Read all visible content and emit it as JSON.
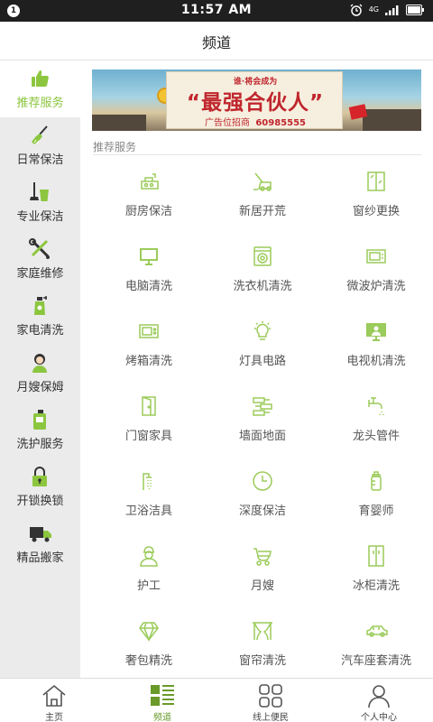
{
  "status_bar": {
    "notification_count": "1",
    "time": "11:57 AM",
    "network": "4G"
  },
  "header": {
    "title": "频道"
  },
  "sidebar": {
    "items": [
      {
        "label": "推荐服务",
        "icon": "thumbs-up-icon",
        "active": true
      },
      {
        "label": "日常保洁",
        "icon": "broom-icon"
      },
      {
        "label": "专业保洁",
        "icon": "mop-bucket-icon"
      },
      {
        "label": "家庭维修",
        "icon": "wrench-screwdriver-icon"
      },
      {
        "label": "家电清洗",
        "icon": "spray-bottle-icon"
      },
      {
        "label": "月嫂保姆",
        "icon": "nanny-icon"
      },
      {
        "label": "洗护服务",
        "icon": "detergent-icon"
      },
      {
        "label": "开锁换锁",
        "icon": "lock-icon"
      },
      {
        "label": "精品搬家",
        "icon": "truck-icon"
      }
    ]
  },
  "banner": {
    "top_text": "谁·将会成为",
    "headline": "“最强合伙人”",
    "sub_text": "广告位招商",
    "phone": "60985555"
  },
  "main": {
    "section_title": "推荐服务",
    "services": [
      {
        "label": "厨房保洁",
        "icon": "range-hood-icon"
      },
      {
        "label": "新居开荒",
        "icon": "vacuum-icon"
      },
      {
        "label": "窗纱更换",
        "icon": "window-icon"
      },
      {
        "label": "电脑清洗",
        "icon": "monitor-icon"
      },
      {
        "label": "洗衣机清洗",
        "icon": "washing-machine-icon"
      },
      {
        "label": "微波炉清洗",
        "icon": "microwave-icon"
      },
      {
        "label": "烤箱清洗",
        "icon": "oven-icon"
      },
      {
        "label": "灯具电路",
        "icon": "light-bulb-icon"
      },
      {
        "label": "电视机清洗",
        "icon": "tv-icon"
      },
      {
        "label": "门窗家具",
        "icon": "door-icon"
      },
      {
        "label": "墙面地面",
        "icon": "wall-bricks-icon"
      },
      {
        "label": "龙头管件",
        "icon": "faucet-icon"
      },
      {
        "label": "卫浴洁具",
        "icon": "shower-icon"
      },
      {
        "label": "深度保洁",
        "icon": "clock-icon"
      },
      {
        "label": "育婴师",
        "icon": "baby-bottle-icon"
      },
      {
        "label": "护工",
        "icon": "caregiver-icon"
      },
      {
        "label": "月嫂",
        "icon": "stroller-icon"
      },
      {
        "label": "冰柜清洗",
        "icon": "fridge-icon"
      },
      {
        "label": "奢包精洗",
        "icon": "diamond-icon"
      },
      {
        "label": "窗帘清洗",
        "icon": "curtain-icon"
      },
      {
        "label": "汽车座套清洗",
        "icon": "car-icon"
      }
    ]
  },
  "tabbar": {
    "items": [
      {
        "label": "主页",
        "icon": "home-icon"
      },
      {
        "label": "频道",
        "icon": "channel-list-icon",
        "active": true
      },
      {
        "label": "线上便民",
        "icon": "grid-icon"
      },
      {
        "label": "个人中心",
        "icon": "person-icon"
      }
    ]
  },
  "colors": {
    "accent": "#8cc63f",
    "sidebar_bg": "#ebebeb",
    "status_bar_bg": "#1f1f1f"
  }
}
